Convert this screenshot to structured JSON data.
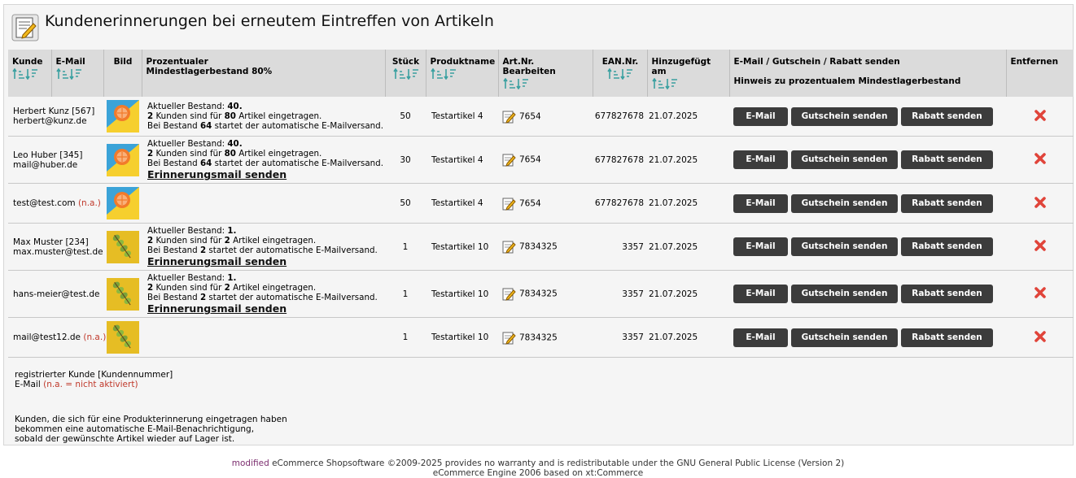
{
  "page": {
    "title": "Kundenerinnerungen bei erneutem Eintreffen von Artikeln"
  },
  "table": {
    "headers": {
      "kunde": "Kunde",
      "email": "E-Mail",
      "bild": "Bild",
      "prozent_1": "Prozentualer",
      "prozent_2": "Mindestlagerbestand 80%",
      "stueck": "Stück",
      "produktname": "Produktname",
      "artnr": "Art.Nr. Bearbeiten",
      "ean": "EAN.Nr.",
      "hinzugefuegt": "Hinzugefügt am",
      "aktionen_1": "E-Mail / Gutschein / Rabatt senden",
      "aktionen_2": "Hinweis zu prozentualem Mindestlagerbestand",
      "entfernen": "Entfernen"
    },
    "rows": [
      {
        "name": "Herbert Kunz [567]",
        "email": "herbert@kunz.de",
        "na": "",
        "image": "orange",
        "stock_label": "Aktueller Bestand: ",
        "stock": "40.",
        "count": "2",
        "mid": " Kunden sind für ",
        "qty": "80",
        "tail": " Artikel eingetragen.",
        "thr_pre": "Bei Bestand ",
        "thr": "64",
        "thr_post": " startet der automatische E-Mailversand.",
        "reminder": "",
        "stueck": "50",
        "produkt": "Testartikel 4",
        "artnr": "7654",
        "ean": "677827678",
        "datum": "21.07.2025"
      },
      {
        "name": "Leo Huber [345]",
        "email": "mail@huber.de",
        "na": "",
        "image": "orange",
        "stock_label": "Aktueller Bestand: ",
        "stock": "40.",
        "count": "2",
        "mid": " Kunden sind für ",
        "qty": "80",
        "tail": " Artikel eingetragen.",
        "thr_pre": "Bei Bestand ",
        "thr": "64",
        "thr_post": " startet der automatische E-Mailversand.",
        "reminder": "Erinnerungsmail senden",
        "stueck": "30",
        "produkt": "Testartikel 4",
        "artnr": "7654",
        "ean": "677827678",
        "datum": "21.07.2025"
      },
      {
        "name": "",
        "email": "test@test.com",
        "na": "(n.a.)",
        "image": "orange",
        "stock_label": "",
        "stock": "",
        "count": "",
        "mid": "",
        "qty": "",
        "tail": "",
        "thr_pre": "",
        "thr": "",
        "thr_post": "",
        "reminder": "",
        "stueck": "50",
        "produkt": "Testartikel 4",
        "artnr": "7654",
        "ean": "677827678",
        "datum": "21.07.2025"
      },
      {
        "name": "Max Muster [234]",
        "email": "max.muster@test.de",
        "na": "",
        "image": "kiwi",
        "stock_label": "Aktueller Bestand: ",
        "stock": "1.",
        "count": "2",
        "mid": " Kunden sind für ",
        "qty": "2",
        "tail": " Artikel eingetragen.",
        "thr_pre": "Bei Bestand ",
        "thr": "2",
        "thr_post": " startet der automatische E-Mailversand.",
        "reminder": "Erinnerungsmail senden",
        "stueck": "1",
        "produkt": "Testartikel 10",
        "artnr": "7834325",
        "ean": "3357",
        "datum": "21.07.2025"
      },
      {
        "name": "",
        "email": "hans-meier@test.de",
        "na": "",
        "image": "kiwi",
        "stock_label": "Aktueller Bestand: ",
        "stock": "1.",
        "count": "2",
        "mid": " Kunden sind für ",
        "qty": "2",
        "tail": " Artikel eingetragen.",
        "thr_pre": "Bei Bestand ",
        "thr": "2",
        "thr_post": " startet der automatische E-Mailversand.",
        "reminder": "Erinnerungsmail senden",
        "stueck": "1",
        "produkt": "Testartikel 10",
        "artnr": "7834325",
        "ean": "3357",
        "datum": "21.07.2025"
      },
      {
        "name": "",
        "email": "mail@test12.de",
        "na": "(n.a.)",
        "image": "kiwi",
        "stock_label": "",
        "stock": "",
        "count": "",
        "mid": "",
        "qty": "",
        "tail": "",
        "thr_pre": "",
        "thr": "",
        "thr_post": "",
        "reminder": "",
        "stueck": "1",
        "produkt": "Testartikel 10",
        "artnr": "7834325",
        "ean": "3357",
        "datum": "21.07.2025"
      }
    ]
  },
  "buttons": {
    "email": "E-Mail",
    "gutschein": "Gutschein senden",
    "rabatt": "Rabatt senden"
  },
  "legend": {
    "line1": "registrierter Kunde [Kundennummer]",
    "line2": "E-Mail ",
    "line2_na": "(n.a. = nicht aktiviert)"
  },
  "note": {
    "line1": "Kunden, die sich für eine Produkterinnerung eingetragen haben",
    "line2": "bekommen eine automatische E-Mail-Benachrichtigung,",
    "line3": "sobald der gewünschte Artikel wieder auf Lager ist."
  },
  "footer": {
    "brand": "modified",
    "line1": " eCommerce Shopsoftware ©2009-2025 provides no warranty and is redistributable under the GNU General Public License (Version 2)",
    "line2": "eCommerce Engine 2006 based on xt:Commerce"
  },
  "colors": {
    "button_bg": "#3c3c3c",
    "remove_red": "#e0443a",
    "header_bg": "#dbdbdb",
    "sort_green": "#3aa0a0"
  }
}
